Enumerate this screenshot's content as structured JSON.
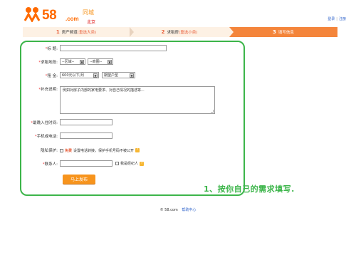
{
  "header": {
    "logo_text": "58",
    "logo_com": ".com",
    "logo_city_label": "同城",
    "location": "北京",
    "links": [
      "登录",
      "注册"
    ],
    "link_separator": "|"
  },
  "steps": [
    {
      "num": "1",
      "label": "房产频道",
      "sub": "(重选大类)"
    },
    {
      "num": "2",
      "label": "求租房",
      "sub": "(重选小类)"
    },
    {
      "num": "3",
      "label": "填写信息",
      "sub": ""
    }
  ],
  "form": {
    "title_label": "标 题:",
    "title_value": "",
    "area_label": "求租地段:",
    "district_select": "--区域--",
    "subarea_select": "--商圈--",
    "rent_label": "租 金:",
    "rent_select": "600元以下/月",
    "rent_type_select": "期望户型",
    "desc_label": "补充说明:",
    "desc_value": "例如对房子内部的家电要求、对自己情况的描述等...",
    "move_in_label": "最晚入住时间:",
    "move_in_value": "",
    "phone_label": "手机或电话:",
    "phone_value": "",
    "privacy_label": "隐私保护:",
    "privacy_free": "免费",
    "privacy_text": "设置电话转接，保护手机号码不被公开",
    "help_mark": "?",
    "contact_label": "联系人:",
    "contact_value": "",
    "agent_label": "我是经纪人",
    "submit_label": "马上发布",
    "required_mark": "*"
  },
  "annotation": "1、按你自己的需求填写.",
  "footer": {
    "copyright": "© 58.com",
    "help_link": "帮助中心"
  },
  "colors": {
    "brand": "#ff6a00",
    "step_active": "#f4853b",
    "highlight": "#3cb54a",
    "submit": "#f7941d"
  }
}
